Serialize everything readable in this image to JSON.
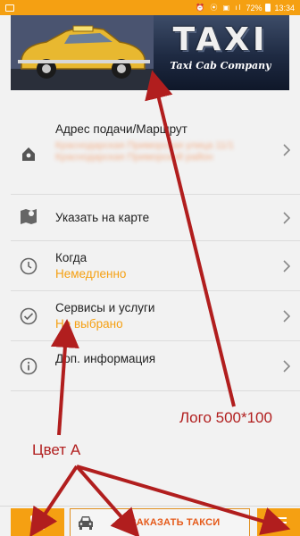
{
  "status_bar": {
    "battery": "72%",
    "time": "13:34",
    "color": "#f5a012"
  },
  "banner": {
    "logo_title": "TAXI",
    "logo_subtitle": "Taxi Cab Company"
  },
  "menu": {
    "items": [
      {
        "title": "Адрес подачи/Маршрут",
        "value": "",
        "icon": "home-icon"
      },
      {
        "title": "Указать на карте",
        "value": "",
        "icon": "map-icon"
      },
      {
        "title": "Когда",
        "value": "Немедленно",
        "icon": "clock-icon"
      },
      {
        "title": "Сервисы и услуги",
        "value": "Не выбрано",
        "icon": "check-circle-icon"
      },
      {
        "title": "Доп. информация",
        "value": "",
        "icon": "info-icon"
      }
    ],
    "address_blurred": "Краснодарская Приморская улица 11/1 Краснодарская Приморский район",
    "accent_color": "#f5a012"
  },
  "bottom_bar": {
    "order_label": "ЗАКАЗАТЬ ТАКСИ",
    "call_icon": "phone-icon",
    "menu_icon": "hamburger-icon",
    "car_icon": "car-icon"
  },
  "annotations": {
    "logo_note": "Лого 500*100",
    "color_note": "Цвет А",
    "arrow_color": "#b11e1e"
  }
}
